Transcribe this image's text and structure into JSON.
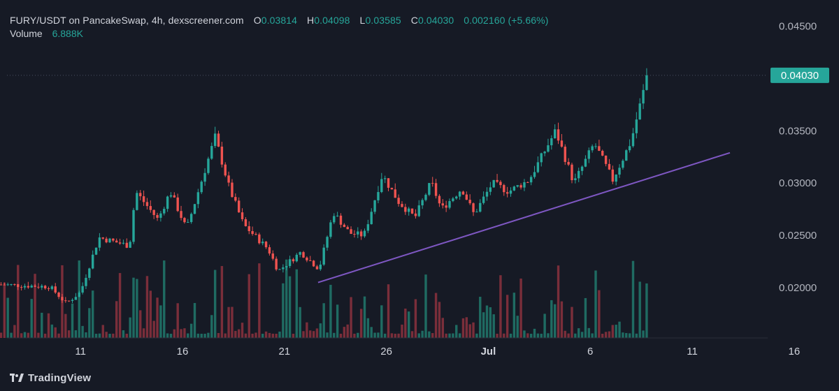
{
  "header": {
    "symbol": "FURY/USDT on PancakeSwap, 4h, dexscreener.com",
    "o_label": "O",
    "o_value": "0.03814",
    "h_label": "H",
    "h_value": "0.04098",
    "l_label": "L",
    "l_value": "0.03585",
    "c_label": "C",
    "c_value": "0.04030",
    "change": "0.002160 (+5.66%)",
    "volume_label": "Volume",
    "volume_value": "6.888K"
  },
  "footer": {
    "brand": "TradingView"
  },
  "colors": {
    "background": "#161a25",
    "up": "#26a69a",
    "down": "#ef5350",
    "up_volume": "#1f6b62",
    "down_volume": "#7a2e3a",
    "trendline": "#7e57c2",
    "price_tag": "#26a69a"
  },
  "chart_data": {
    "type": "candlestick",
    "interval": "4h",
    "y_axis": {
      "ticks": [
        0.02,
        0.025,
        0.03,
        0.035,
        0.045
      ],
      "tick_labels": [
        "0.02000",
        "0.02500",
        "0.03000",
        "0.03500",
        "0.04500"
      ],
      "range": [
        0.0152,
        0.0475
      ]
    },
    "x_axis": {
      "ticks": [
        {
          "label": "11",
          "t": 11
        },
        {
          "label": "16",
          "t": 16
        },
        {
          "label": "21",
          "t": 21
        },
        {
          "label": "26",
          "t": 26
        },
        {
          "label": "Jul",
          "t": 31
        },
        {
          "label": "6",
          "t": 36
        },
        {
          "label": "11",
          "t": 41
        },
        {
          "label": "16",
          "t": 46
        }
      ],
      "range": [
        7.05,
        48.2
      ]
    },
    "last_price": 0.0403,
    "last_price_label": "0.04030",
    "trendline": {
      "from": [
        22.65,
        0.0205
      ],
      "to": [
        42.85,
        0.0329
      ]
    },
    "grid": false,
    "volume_pane": true,
    "key_points": [
      {
        "t": 7.1,
        "close": 0.0203
      },
      {
        "t": 9.5,
        "close": 0.0201
      },
      {
        "t": 10.3,
        "close": 0.0185
      },
      {
        "t": 11.0,
        "close": 0.0196
      },
      {
        "t": 11.9,
        "close": 0.0248
      },
      {
        "t": 13.4,
        "close": 0.024
      },
      {
        "t": 13.7,
        "close": 0.0292
      },
      {
        "t": 14.8,
        "close": 0.0265
      },
      {
        "t": 15.4,
        "close": 0.0292
      },
      {
        "t": 16.2,
        "close": 0.0256
      },
      {
        "t": 17.6,
        "close": 0.0344
      },
      {
        "t": 18.3,
        "close": 0.0295
      },
      {
        "t": 19.0,
        "close": 0.026
      },
      {
        "t": 20.2,
        "close": 0.0237
      },
      {
        "t": 20.7,
        "close": 0.0216
      },
      {
        "t": 21.8,
        "close": 0.0234
      },
      {
        "t": 22.7,
        "close": 0.0218
      },
      {
        "t": 23.4,
        "close": 0.0272
      },
      {
        "t": 24.2,
        "close": 0.0252
      },
      {
        "t": 24.9,
        "close": 0.025
      },
      {
        "t": 25.8,
        "close": 0.0308
      },
      {
        "t": 26.6,
        "close": 0.0282
      },
      {
        "t": 27.4,
        "close": 0.0267
      },
      {
        "t": 28.2,
        "close": 0.0301
      },
      {
        "t": 28.7,
        "close": 0.0275
      },
      {
        "t": 29.7,
        "close": 0.0295
      },
      {
        "t": 30.3,
        "close": 0.027
      },
      {
        "t": 31.2,
        "close": 0.03
      },
      {
        "t": 32.0,
        "close": 0.0292
      },
      {
        "t": 33.0,
        "close": 0.0303
      },
      {
        "t": 34.3,
        "close": 0.035
      },
      {
        "t": 35.2,
        "close": 0.03
      },
      {
        "t": 36.2,
        "close": 0.0338
      },
      {
        "t": 37.1,
        "close": 0.0303
      },
      {
        "t": 38.0,
        "close": 0.034
      },
      {
        "t": 38.8,
        "close": 0.0403
      }
    ]
  }
}
